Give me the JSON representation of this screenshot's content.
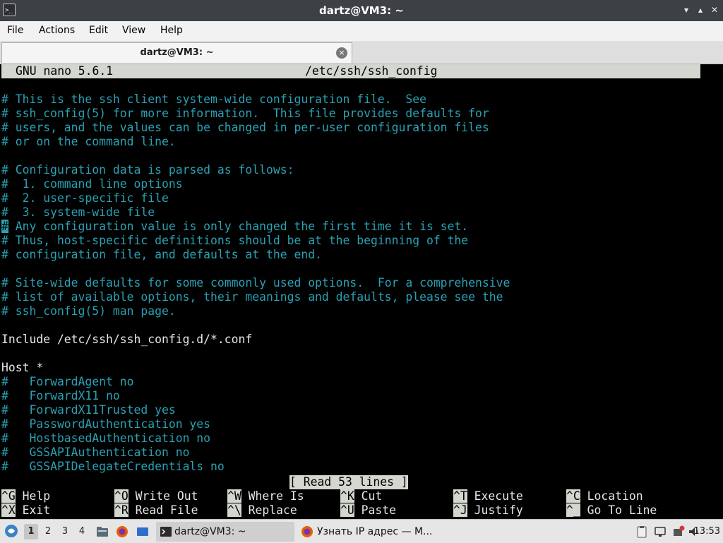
{
  "window": {
    "title": "dartz@VM3: ~",
    "app_icon_glyph": ">_",
    "controls": [
      "▾",
      "▴",
      "✕"
    ]
  },
  "menu": [
    "File",
    "Actions",
    "Edit",
    "View",
    "Help"
  ],
  "tab": {
    "label": "dartz@VM3: ~",
    "close_glyph": "×"
  },
  "nano": {
    "version": "GNU nano 5.6.1",
    "filename": "/etc/ssh/ssh_config",
    "status": "[ Read 53 lines ]",
    "lines": [
      "# This is the ssh client system-wide configuration file.  See",
      "# ssh_config(5) for more information.  This file provides defaults for",
      "# users, and the values can be changed in per-user configuration files",
      "# or on the command line.",
      "",
      "# Configuration data is parsed as follows:",
      "#  1. command line options",
      "#  2. user-specific file",
      "#  3. system-wide file",
      "# Any configuration value is only changed the first time it is set.",
      "# Thus, host-specific definitions should be at the beginning of the",
      "# configuration file, and defaults at the end.",
      "",
      "# Site-wide defaults for some commonly used options.  For a comprehensive",
      "# list of available options, their meanings and defaults, please see the",
      "# ssh_config(5) man page.",
      "",
      "Include /etc/ssh/ssh_config.d/*.conf",
      "",
      "Host *",
      "#   ForwardAgent no",
      "#   ForwardX11 no",
      "#   ForwardX11Trusted yes",
      "#   PasswordAuthentication yes",
      "#   HostbasedAuthentication no",
      "#   GSSAPIAuthentication no",
      "#   GSSAPIDelegateCredentials no"
    ],
    "shortcuts": [
      [
        {
          "key": "^G",
          "label": "Help"
        },
        {
          "key": "^X",
          "label": "Exit"
        }
      ],
      [
        {
          "key": "^O",
          "label": "Write Out"
        },
        {
          "key": "^R",
          "label": "Read File"
        }
      ],
      [
        {
          "key": "^W",
          "label": "Where Is"
        },
        {
          "key": "^\\",
          "label": "Replace"
        }
      ],
      [
        {
          "key": "^K",
          "label": "Cut"
        },
        {
          "key": "^U",
          "label": "Paste"
        }
      ],
      [
        {
          "key": "^T",
          "label": "Execute"
        },
        {
          "key": "^J",
          "label": "Justify"
        }
      ],
      [
        {
          "key": "^C",
          "label": "Location"
        },
        {
          "key": "^_",
          "label": "Go To Line"
        }
      ]
    ]
  },
  "taskbar": {
    "workspaces": [
      "1",
      "2",
      "3",
      "4"
    ],
    "tasks": [
      {
        "label": "dartz@VM3: ~",
        "icon": "terminal-icon",
        "active": true
      },
      {
        "label": "Узнать IP адрес — M...",
        "icon": "firefox-icon",
        "active": false
      }
    ],
    "clock": "13:53"
  },
  "colors": {
    "comment": "#2aa1b3",
    "text": "#e6e6e6",
    "bar": "#d3d7cf",
    "terminal_bg": "#000000",
    "titlebar": "#3d4045"
  }
}
